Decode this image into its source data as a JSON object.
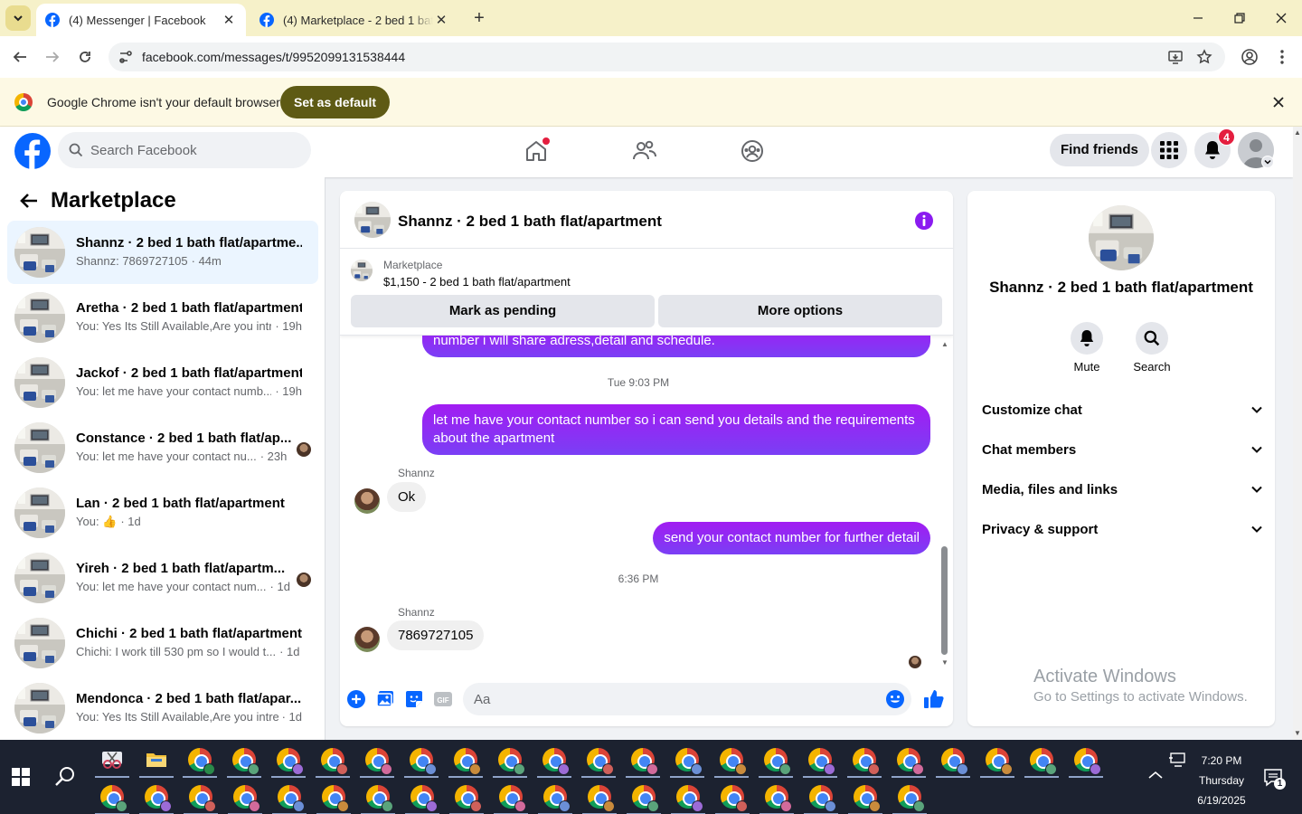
{
  "browser": {
    "tabs": [
      {
        "title": "(4) Messenger | Facebook",
        "active": true
      },
      {
        "title": "(4) Marketplace - 2 bed 1 bath flat/apartment",
        "active": false
      }
    ],
    "url": "facebook.com/messages/t/9952099131538444",
    "infobar": {
      "message": "Google Chrome isn't your default browser",
      "cta": "Set as default"
    },
    "accent": "#5e5a14"
  },
  "fb_header": {
    "search_placeholder": "Search Facebook",
    "find_friends": "Find friends",
    "notification_count": "4",
    "brand_color": "#0866ff"
  },
  "sidebar": {
    "title": "Marketplace",
    "conversations": [
      {
        "name": "Shannz · 2 bed 1 bath flat/apartme...",
        "preview": "Shannz: 7869727105",
        "time": "· 44m",
        "active": true,
        "seen": false
      },
      {
        "name": "Aretha · 2 bed 1 bath flat/apartment",
        "preview": "You: Yes Its Still Available,Are you intr...",
        "time": "· 19h",
        "active": false,
        "seen": false
      },
      {
        "name": "Jackof · 2 bed 1 bath flat/apartment",
        "preview": "You: let me have your contact numb...",
        "time": "· 19h",
        "active": false,
        "seen": false
      },
      {
        "name": "Constance · 2 bed 1 bath flat/ap...",
        "preview": "You: let me have your contact nu...",
        "time": "· 23h",
        "active": false,
        "seen": true
      },
      {
        "name": "Lan · 2 bed 1 bath flat/apartment",
        "preview": "You: 👍",
        "time": "· 1d",
        "active": false,
        "seen": false
      },
      {
        "name": "Yireh · 2 bed 1 bath flat/apartm...",
        "preview": "You: let me have your contact num...",
        "time": "· 1d",
        "active": false,
        "seen": true
      },
      {
        "name": "Chichi · 2 bed 1 bath flat/apartment",
        "preview": "Chichi: I work till 530 pm so I would t...",
        "time": "· 1d",
        "active": false,
        "seen": false
      },
      {
        "name": "Mendonca · 2 bed 1 bath flat/apar...",
        "preview": "You: Yes Its Still Available,Are you intre...",
        "time": "· 1d",
        "active": false,
        "seen": false
      }
    ]
  },
  "chat": {
    "title": "Shannz · 2 bed 1 bath flat/apartment",
    "listing": {
      "source": "Marketplace",
      "description": "$1,150 - 2 bed 1 bath flat/apartment",
      "mark_pending": "Mark as pending",
      "more_options": "More options"
    },
    "messages": {
      "partial_out": "number i will share adress,detail and schedule.",
      "stamp1": "Tue 9:03 PM",
      "out1": "let me have your contact number so i can send you details and the requirements about the apartment",
      "sender1": "Shannz",
      "in1": "Ok",
      "out2": "send your contact number for further detail",
      "stamp2": "6:36 PM",
      "sender2": "Shannz",
      "in2": "7869727105"
    },
    "composer_placeholder": "Aa",
    "accent": "#8a1bf0"
  },
  "info_panel": {
    "name": "Shannz · 2 bed 1 bath flat/apartment",
    "actions": [
      {
        "label": "Mute"
      },
      {
        "label": "Search"
      }
    ],
    "sections": [
      "Customize chat",
      "Chat members",
      "Media, files and links",
      "Privacy & support"
    ],
    "watermark_title": "Activate Windows",
    "watermark_sub": "Go to Settings to activate Windows."
  },
  "taskbar": {
    "time": "7:20 PM",
    "day": "Thursday",
    "date": "6/19/2025",
    "notification_count": "1"
  }
}
